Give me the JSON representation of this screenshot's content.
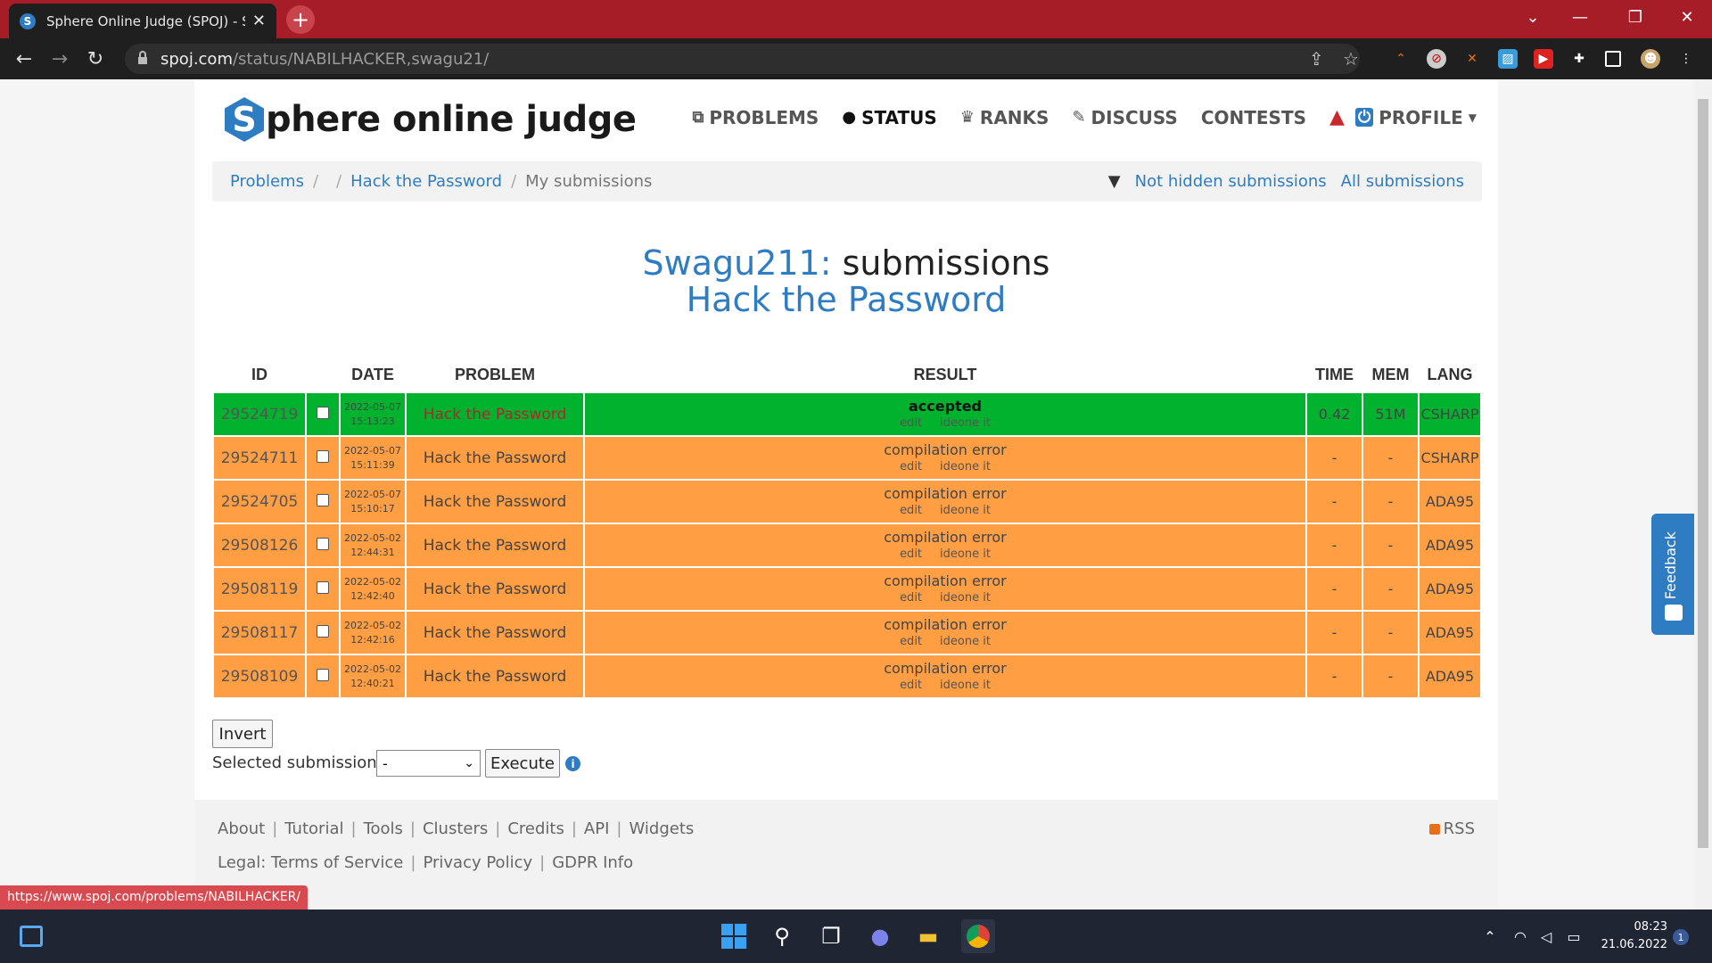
{
  "browser": {
    "tab_title": "Sphere Online Judge (SPOJ) - Sta",
    "url_host": "spoj.com",
    "url_path": "/status/NABILHACKER,swagu21/"
  },
  "site": {
    "logo_letter": "S",
    "logo_text": "phere online judge",
    "nav": [
      {
        "label": "PROBLEMS",
        "icon": "puzzle-icon"
      },
      {
        "label": "STATUS",
        "icon": "circle-icon"
      },
      {
        "label": "RANKS",
        "icon": "trophy-icon"
      },
      {
        "label": "DISCUSS",
        "icon": "chat-icon"
      },
      {
        "label": "CONTESTS",
        "icon": ""
      },
      {
        "label": "PROFILE",
        "icon": "power-icon"
      }
    ]
  },
  "breadcrumb": {
    "items": [
      "Problems",
      "Hack the Password",
      "My submissions"
    ],
    "filter_label": "Not hidden submissions",
    "all_label": "All submissions"
  },
  "heading": {
    "user": "Swagu211:",
    "suffix": " submissions",
    "problem": "Hack the Password"
  },
  "table": {
    "headers": [
      "ID",
      "DATE",
      "PROBLEM",
      "RESULT",
      "TIME",
      "MEM",
      "LANG"
    ],
    "link_edit": "edit",
    "link_ideone": "ideone it",
    "rows": [
      {
        "id": "29524719",
        "date": "2022-05-07",
        "time_of_day": "15:13:23",
        "problem": "Hack the Password",
        "result": "accepted",
        "time": "0.42",
        "mem": "51M",
        "lang": "CSHARP",
        "status": "accepted"
      },
      {
        "id": "29524711",
        "date": "2022-05-07",
        "time_of_day": "15:11:39",
        "problem": "Hack the Password",
        "result": "compilation error",
        "time": "-",
        "mem": "-",
        "lang": "CSHARP",
        "status": "error"
      },
      {
        "id": "29524705",
        "date": "2022-05-07",
        "time_of_day": "15:10:17",
        "problem": "Hack the Password",
        "result": "compilation error",
        "time": "-",
        "mem": "-",
        "lang": "ADA95",
        "status": "error"
      },
      {
        "id": "29508126",
        "date": "2022-05-02",
        "time_of_day": "12:44:31",
        "problem": "Hack the Password",
        "result": "compilation error",
        "time": "-",
        "mem": "-",
        "lang": "ADA95",
        "status": "error"
      },
      {
        "id": "29508119",
        "date": "2022-05-02",
        "time_of_day": "12:42:40",
        "problem": "Hack the Password",
        "result": "compilation error",
        "time": "-",
        "mem": "-",
        "lang": "ADA95",
        "status": "error"
      },
      {
        "id": "29508117",
        "date": "2022-05-02",
        "time_of_day": "12:42:16",
        "problem": "Hack the Password",
        "result": "compilation error",
        "time": "-",
        "mem": "-",
        "lang": "ADA95",
        "status": "error"
      },
      {
        "id": "29508109",
        "date": "2022-05-02",
        "time_of_day": "12:40:21",
        "problem": "Hack the Password",
        "result": "compilation error",
        "time": "-",
        "mem": "-",
        "lang": "ADA95",
        "status": "error"
      }
    ]
  },
  "actions": {
    "invert": "Invert",
    "selected_label": "Selected submissions:",
    "select_value": "-",
    "execute": "Execute"
  },
  "footer": {
    "links": [
      "About",
      "Tutorial",
      "Tools",
      "Clusters",
      "Credits",
      "API",
      "Widgets"
    ],
    "rss": "RSS",
    "legal_prefix": "Legal:",
    "legal": [
      "Terms of Service",
      "Privacy Policy",
      "GDPR Info"
    ]
  },
  "status_url": "https://www.spoj.com/problems/NABILHACKER/",
  "feedback": "Feedback",
  "taskbar": {
    "time": "08:23",
    "date": "21.06.2022"
  },
  "colors": {
    "accent": "#2e7cc2",
    "accepted": "#01b22e",
    "error": "#ff9e42",
    "titlebar": "#a61d27"
  }
}
